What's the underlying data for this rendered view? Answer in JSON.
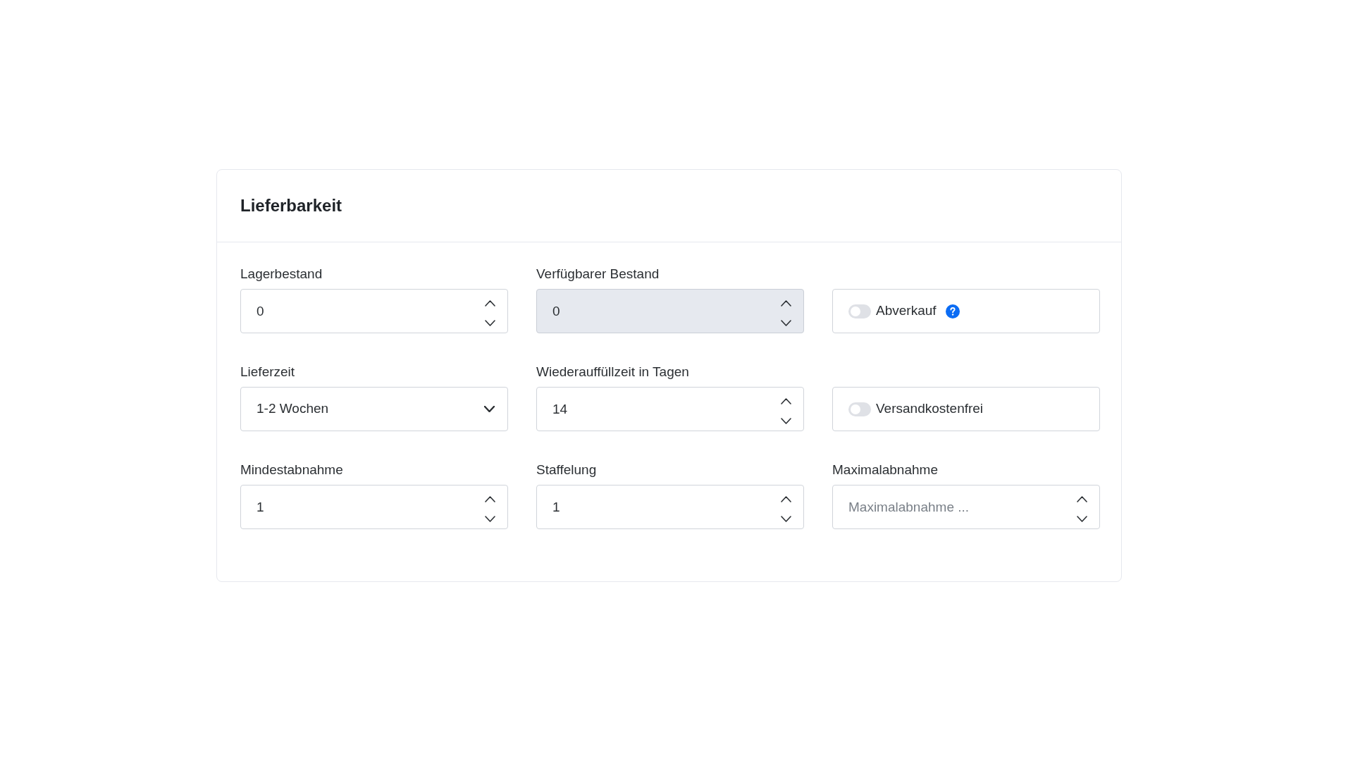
{
  "card": {
    "title": "Lieferbarkeit"
  },
  "fields": [
    {
      "kind": "number",
      "label": "Lagerbestand",
      "value": "0",
      "disabled": false
    },
    {
      "kind": "number",
      "label": "Verfügbarer Bestand",
      "value": "0",
      "disabled": true
    },
    {
      "kind": "toggle",
      "label": "Abverkauf",
      "on": false,
      "help": true
    },
    {
      "kind": "select",
      "label": "Lieferzeit",
      "value": "1-2 Wochen"
    },
    {
      "kind": "number",
      "label": "Wiederauffüllzeit in Tagen",
      "value": "14",
      "disabled": false
    },
    {
      "kind": "toggle",
      "label": "Versandkostenfrei",
      "on": false,
      "help": false
    },
    {
      "kind": "number",
      "label": "Mindestabnahme",
      "value": "1",
      "disabled": false
    },
    {
      "kind": "number",
      "label": "Staffelung",
      "value": "1",
      "disabled": false
    },
    {
      "kind": "number",
      "label": "Maximalabnahme",
      "placeholder": "Maximalabnahme ...",
      "disabled": false
    }
  ]
}
